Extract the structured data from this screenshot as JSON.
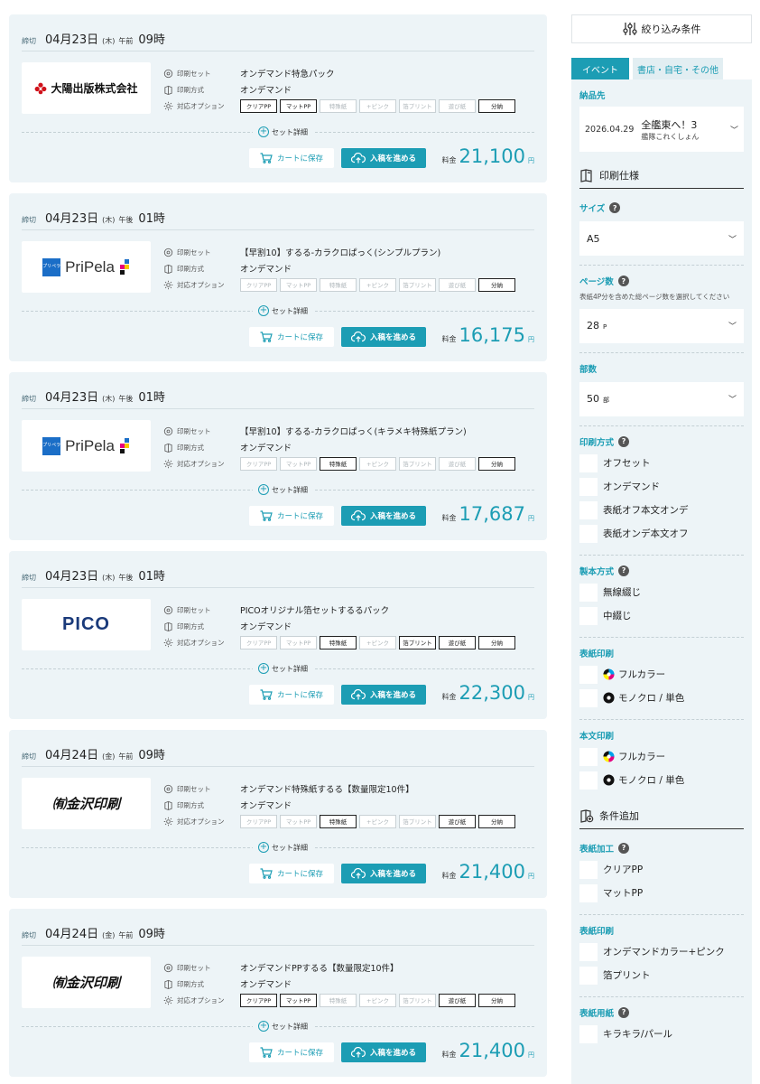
{
  "cards": [
    {
      "deadline_tag": "締切",
      "date": "04月23日",
      "dow": "(木)",
      "ampm": "午前",
      "hour": "09時",
      "logo": {
        "type": "taiyo",
        "text": "大陽出版株式会社"
      },
      "labels": {
        "set": "印刷セット",
        "method": "印刷方式",
        "options": "対応オプション"
      },
      "set_name": "オンデマンド特急パック",
      "method": "オンデマンド",
      "options": [
        {
          "label": "クリアPP",
          "on": true
        },
        {
          "label": "マットPP",
          "on": true
        },
        {
          "label": "特殊紙",
          "on": false
        },
        {
          "label": "+ピンク",
          "on": false
        },
        {
          "label": "箔プリント",
          "on": false
        },
        {
          "label": "遊び紙",
          "on": false
        },
        {
          "label": "分納",
          "on": true
        }
      ],
      "set_detail": "セット詳細",
      "cart": "カートに保存",
      "proceed": "入稿を進める",
      "price_label": "料金",
      "price": "21,100",
      "unit": "円"
    },
    {
      "deadline_tag": "締切",
      "date": "04月23日",
      "dow": "(木)",
      "ampm": "午後",
      "hour": "01時",
      "logo": {
        "type": "pripela",
        "text": "PriPela",
        "badge": "プリペラ"
      },
      "labels": {
        "set": "印刷セット",
        "method": "印刷方式",
        "options": "対応オプション"
      },
      "set_name": "【早割10】するる-カラクロぱっく(シンプルプラン)",
      "method": "オンデマンド",
      "options": [
        {
          "label": "クリアPP",
          "on": false
        },
        {
          "label": "マットPP",
          "on": false
        },
        {
          "label": "特殊紙",
          "on": false
        },
        {
          "label": "+ピンク",
          "on": false
        },
        {
          "label": "箔プリント",
          "on": false
        },
        {
          "label": "遊び紙",
          "on": false
        },
        {
          "label": "分納",
          "on": true
        }
      ],
      "set_detail": "セット詳細",
      "cart": "カートに保存",
      "proceed": "入稿を進める",
      "price_label": "料金",
      "price": "16,175",
      "unit": "円"
    },
    {
      "deadline_tag": "締切",
      "date": "04月23日",
      "dow": "(木)",
      "ampm": "午後",
      "hour": "01時",
      "logo": {
        "type": "pripela",
        "text": "PriPela",
        "badge": "プリペラ"
      },
      "labels": {
        "set": "印刷セット",
        "method": "印刷方式",
        "options": "対応オプション"
      },
      "set_name": "【早割10】するる-カラクロぱっく(キラメキ特殊紙プラン)",
      "method": "オンデマンド",
      "options": [
        {
          "label": "クリアPP",
          "on": false
        },
        {
          "label": "マットPP",
          "on": false
        },
        {
          "label": "特殊紙",
          "on": true
        },
        {
          "label": "+ピンク",
          "on": false
        },
        {
          "label": "箔プリント",
          "on": false
        },
        {
          "label": "遊び紙",
          "on": false
        },
        {
          "label": "分納",
          "on": true
        }
      ],
      "set_detail": "セット詳細",
      "cart": "カートに保存",
      "proceed": "入稿を進める",
      "price_label": "料金",
      "price": "17,687",
      "unit": "円"
    },
    {
      "deadline_tag": "締切",
      "date": "04月23日",
      "dow": "(木)",
      "ampm": "午後",
      "hour": "01時",
      "logo": {
        "type": "pico",
        "text": "PICO"
      },
      "labels": {
        "set": "印刷セット",
        "method": "印刷方式",
        "options": "対応オプション"
      },
      "set_name": "PICOオリジナル箔セットするるパック",
      "method": "オンデマンド",
      "options": [
        {
          "label": "クリアPP",
          "on": false
        },
        {
          "label": "マットPP",
          "on": false
        },
        {
          "label": "特殊紙",
          "on": true
        },
        {
          "label": "+ピンク",
          "on": false
        },
        {
          "label": "箔プリント",
          "on": true
        },
        {
          "label": "遊び紙",
          "on": true
        },
        {
          "label": "分納",
          "on": true
        }
      ],
      "set_detail": "セット詳細",
      "cart": "カートに保存",
      "proceed": "入稿を進める",
      "price_label": "料金",
      "price": "22,300",
      "unit": "円"
    },
    {
      "deadline_tag": "締切",
      "date": "04月24日",
      "dow": "(金)",
      "ampm": "午前",
      "hour": "09時",
      "logo": {
        "type": "kanazawa",
        "text": "㈲金沢印刷"
      },
      "labels": {
        "set": "印刷セット",
        "method": "印刷方式",
        "options": "対応オプション"
      },
      "set_name": "オンデマンド特殊紙するる【数量限定10件】",
      "method": "オンデマンド",
      "options": [
        {
          "label": "クリアPP",
          "on": false
        },
        {
          "label": "マットPP",
          "on": false
        },
        {
          "label": "特殊紙",
          "on": true
        },
        {
          "label": "+ピンク",
          "on": false
        },
        {
          "label": "箔プリント",
          "on": false
        },
        {
          "label": "遊び紙",
          "on": true
        },
        {
          "label": "分納",
          "on": true
        }
      ],
      "set_detail": "セット詳細",
      "cart": "カートに保存",
      "proceed": "入稿を進める",
      "price_label": "料金",
      "price": "21,400",
      "unit": "円"
    },
    {
      "deadline_tag": "締切",
      "date": "04月24日",
      "dow": "(金)",
      "ampm": "午前",
      "hour": "09時",
      "logo": {
        "type": "kanazawa",
        "text": "㈲金沢印刷"
      },
      "labels": {
        "set": "印刷セット",
        "method": "印刷方式",
        "options": "対応オプション"
      },
      "set_name": "オンデマンドPPするる【数量限定10件】",
      "method": "オンデマンド",
      "options": [
        {
          "label": "クリアPP",
          "on": true
        },
        {
          "label": "マットPP",
          "on": true
        },
        {
          "label": "特殊紙",
          "on": false
        },
        {
          "label": "+ピンク",
          "on": false
        },
        {
          "label": "箔プリント",
          "on": false
        },
        {
          "label": "遊び紙",
          "on": true
        },
        {
          "label": "分納",
          "on": true
        }
      ],
      "set_detail": "セット詳細",
      "cart": "カートに保存",
      "proceed": "入稿を進める",
      "price_label": "料金",
      "price": "21,400",
      "unit": "円"
    }
  ],
  "sidebar": {
    "header": "絞り込み条件",
    "tabs": [
      {
        "label": "イベント",
        "active": true
      },
      {
        "label": "書店・自宅・その他",
        "active": false
      }
    ],
    "delivery": {
      "title": "納品先",
      "date": "2026.04.29",
      "event": "全艦東へ！3",
      "sub": "艦隊これくしょん"
    },
    "spec_header": "印刷仕様",
    "size": {
      "title": "サイズ",
      "value": "A5"
    },
    "pages": {
      "title": "ページ数",
      "help": "表紙4P分を含めた総ページ数を選択してください",
      "value": "28",
      "unit": "P"
    },
    "copies": {
      "title": "部数",
      "value": "50",
      "unit": "部"
    },
    "print_method": {
      "title": "印刷方式",
      "items": [
        "オフセット",
        "オンデマンド",
        "表紙オフ本文オンデ",
        "表紙オンデ本文オフ"
      ]
    },
    "binding": {
      "title": "製本方式",
      "items": [
        "無線綴じ",
        "中綴じ"
      ]
    },
    "cover_print": {
      "title": "表紙印刷",
      "items": [
        {
          "label": "フルカラー",
          "icon": "full-color-icon"
        },
        {
          "label": "モノクロ / 単色",
          "icon": "mono-icon"
        }
      ]
    },
    "body_print": {
      "title": "本文印刷",
      "items": [
        {
          "label": "フルカラー",
          "icon": "full-color-icon"
        },
        {
          "label": "モノクロ / 単色",
          "icon": "mono-icon"
        }
      ]
    },
    "add_header": "条件追加",
    "cover_finish": {
      "title": "表紙加工",
      "items": [
        "クリアPP",
        "マットPP"
      ]
    },
    "cover_print2": {
      "title": "表紙印刷",
      "items": [
        "オンデマンドカラー+ピンク",
        "箔プリント"
      ]
    },
    "cover_paper": {
      "title": "表紙用紙",
      "items": [
        "キラキラ/パール"
      ]
    }
  },
  "colors": {
    "accent": "#1c9db4",
    "card_bg": "#edf4f7"
  }
}
